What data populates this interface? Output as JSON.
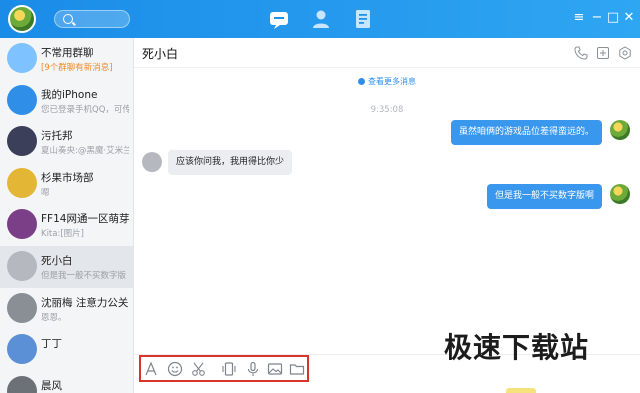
{
  "titlebar": {
    "nav_tabs": [
      "message-tab",
      "contacts-tab",
      "apps-tab"
    ],
    "window_controls": [
      "≡",
      "−",
      "□",
      "✕"
    ]
  },
  "sidebar": {
    "items": [
      {
        "name": "不常用群聊",
        "preview": "[9个群聊有新消息]",
        "alert": true,
        "avatar_color": "#7ec3ff"
      },
      {
        "name": "我的iPhone",
        "preview": "您已登录手机QQ，可传",
        "alert": false,
        "avatar_color": "#2f8ee8"
      },
      {
        "name": "污托邦",
        "preview": "夏山奏央:@黑魔·艾米兰",
        "alert": false,
        "avatar_color": "#3b3f5a"
      },
      {
        "name": "杉果市场部",
        "preview": "嗯",
        "alert": false,
        "avatar_color": "#e4b635"
      },
      {
        "name": "FF14网通一区萌芽",
        "preview": "Kita:[图片]",
        "alert": false,
        "avatar_color": "#7a3f86"
      },
      {
        "name": "死小白",
        "preview": "但是我一般不买数字版",
        "alert": false,
        "avatar_color": "#b5b9bf",
        "selected": true
      },
      {
        "name": "沈丽梅 注意力公关",
        "preview": "恩恩。",
        "alert": false,
        "avatar_color": "#8a8f95"
      },
      {
        "name": "丁丁",
        "preview": "",
        "alert": false,
        "avatar_color": "#5b8fd6"
      },
      {
        "name": "晨风",
        "preview": "",
        "alert": false,
        "avatar_color": "#6c7077"
      }
    ]
  },
  "chat": {
    "title": "死小白",
    "header_icons": [
      "phone-icon",
      "add-member-icon",
      "settings-icon"
    ],
    "more_messages": "查看更多消息",
    "timestamp": "9:35:08",
    "messages": [
      {
        "from": "me",
        "text": "虽然咱俩的游戏品位差得蛮远的。"
      },
      {
        "from": "them",
        "text": "应该你问我，我用得比你少"
      },
      {
        "from": "me",
        "text": "但是我一般不买数字版啊"
      }
    ]
  },
  "toolbar": {
    "tools": [
      "font-icon",
      "emoji-icon",
      "screenshot-scissors-icon",
      "shake-icon",
      "voice-icon",
      "image-icon",
      "file-folder-icon"
    ]
  },
  "watermark": "极速下载站",
  "colors": {
    "accent": "#2f8ee8",
    "titlebar": "#1a8ce8",
    "alert": "#f08a24",
    "highlight_frame": "#d9342b"
  }
}
